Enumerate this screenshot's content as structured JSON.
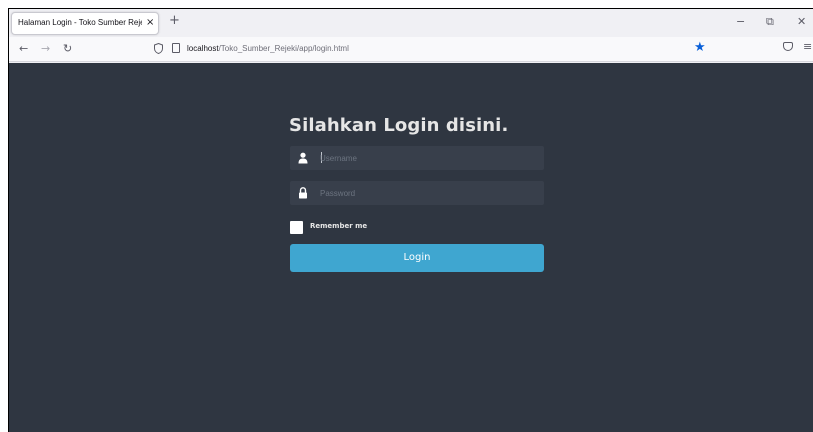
{
  "browser": {
    "tab": {
      "title": "Halaman Login - Toko Sumber Rejeki",
      "close_glyph": "×"
    },
    "new_tab_glyph": "+",
    "window_controls": {
      "minimize": "−",
      "restore": "⧉",
      "close": "✕"
    },
    "nav": {
      "back": "←",
      "forward": "→",
      "reload": "↻"
    },
    "url": {
      "host": "localhost",
      "path": "/Toko_Sumber_Rejeki/app/login.html"
    },
    "icons": [
      "shield-icon",
      "page-icon",
      "bookmark-star-icon",
      "pocket-icon",
      "menu-icon"
    ],
    "menu_glyph": "≡",
    "star_glyph": "★",
    "accent_color": "#0a60d8"
  },
  "page": {
    "background_color": "#2f3641",
    "title": "Silahkan Login disini.",
    "username": {
      "placeholder": "Username",
      "value": "",
      "icon": "user-icon"
    },
    "password": {
      "placeholder": "Password",
      "value": "",
      "icon": "lock-icon"
    },
    "remember_me": {
      "label": "Remember me",
      "checked": false
    },
    "login_button": {
      "label": "Login",
      "color": "#3fa6d0"
    }
  }
}
